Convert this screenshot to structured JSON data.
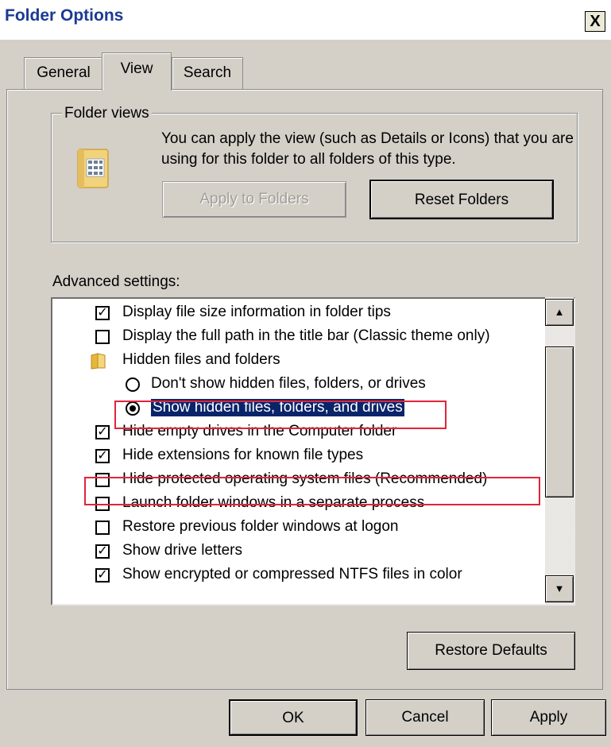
{
  "window": {
    "title": "Folder Options",
    "close_glyph": "X"
  },
  "tabs": [
    {
      "label": "General",
      "active": false
    },
    {
      "label": "View",
      "active": true
    },
    {
      "label": "Search",
      "active": false
    }
  ],
  "folder_views": {
    "legend": "Folder views",
    "description": "You can apply the view (such as Details or Icons) that you are using for this folder to all folders of this type.",
    "icon": "folder-view-icon",
    "apply_button": "Apply to Folders",
    "apply_disabled": true,
    "reset_button": "Reset Folders"
  },
  "advanced": {
    "label": "Advanced settings:",
    "items": [
      {
        "type": "checkbox",
        "checked": true,
        "label": "Display file size information in folder tips"
      },
      {
        "type": "checkbox",
        "checked": false,
        "label": "Display the full path in the title bar (Classic theme only)"
      },
      {
        "type": "folder",
        "label": "Hidden files and folders",
        "icon": "folder-icon"
      },
      {
        "type": "radio",
        "checked": false,
        "label": "Don't show hidden files, folders, or drives"
      },
      {
        "type": "radio",
        "checked": true,
        "label": "Show hidden files, folders, and drives",
        "selected": true,
        "highlighted_box": true
      },
      {
        "type": "checkbox",
        "checked": true,
        "label": "Hide empty drives in the Computer folder"
      },
      {
        "type": "checkbox",
        "checked": true,
        "label": "Hide extensions for known file types"
      },
      {
        "type": "checkbox",
        "checked": false,
        "label": "Hide protected operating system files (Recommended)",
        "highlighted_box": true
      },
      {
        "type": "checkbox",
        "checked": false,
        "label": "Launch folder windows in a separate process"
      },
      {
        "type": "checkbox",
        "checked": false,
        "label": "Restore previous folder windows at logon"
      },
      {
        "type": "checkbox",
        "checked": true,
        "label": "Show drive letters"
      },
      {
        "type": "checkbox",
        "checked": true,
        "label": "Show encrypted or compressed NTFS files in color"
      }
    ],
    "scroll_up_glyph": "▲",
    "scroll_down_glyph": "▼"
  },
  "restore_defaults_button": "Restore Defaults",
  "footer": {
    "ok": "OK",
    "cancel": "Cancel",
    "apply": "Apply"
  },
  "colors": {
    "selection": "#0a246a",
    "annotation_red": "#e2243a",
    "title": "#1b3a93"
  }
}
